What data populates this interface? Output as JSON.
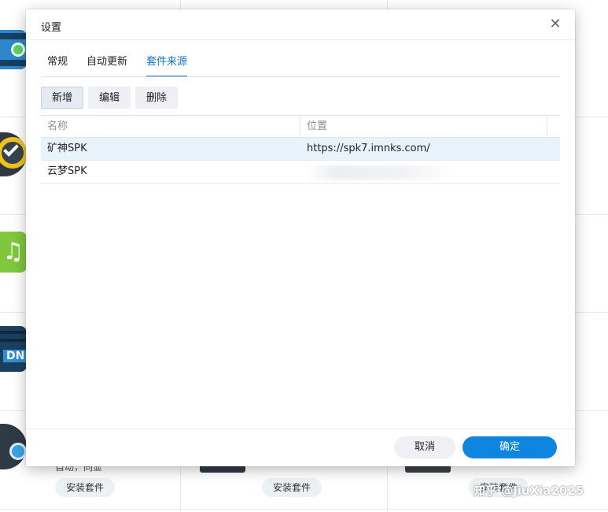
{
  "dialog": {
    "title": "设置",
    "close_symbol": "✕",
    "tabs": [
      {
        "label": "常规",
        "active": false
      },
      {
        "label": "自动更新",
        "active": false
      },
      {
        "label": "套件来源",
        "active": true
      }
    ],
    "toolbar": {
      "add_label": "新增",
      "edit_label": "编辑",
      "delete_label": "删除"
    },
    "table": {
      "columns": [
        "名称",
        "位置"
      ],
      "rows": [
        {
          "name": "矿神SPK",
          "location": "https://spk7.imnks.com/",
          "selected": true
        },
        {
          "name": "云梦SPK",
          "location": "",
          "location_blurred": true,
          "selected": false
        }
      ]
    },
    "footer": {
      "cancel_label": "取消",
      "ok_label": "确定"
    }
  },
  "background": {
    "partial_text": "自动，同显",
    "install_buttons": [
      "安装套件",
      "安装套件",
      "安装套件"
    ],
    "icons": [
      "video-station-icon",
      "clock-check-icon",
      "music-icon",
      "dns-server-icon",
      "network-icon"
    ]
  },
  "watermark": "知乎 @JiuXia2025",
  "colors": {
    "accent": "#0e86e0",
    "tab_active": "#0e74c8",
    "row_selected": "#e9f3fc"
  }
}
